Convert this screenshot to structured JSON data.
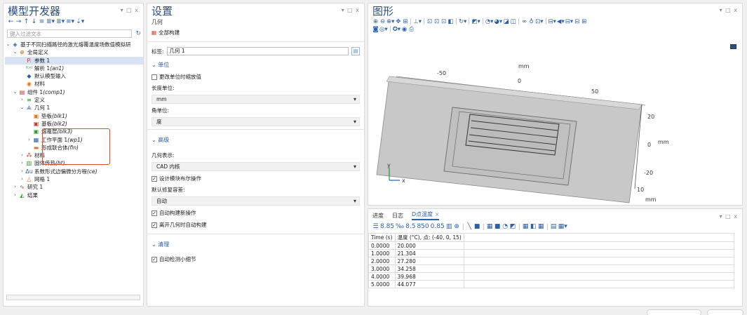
{
  "model_builder": {
    "title": "模型开发器",
    "window_controls": "▾ □ ⅹ",
    "filter_placeholder": "键入过滤文本",
    "tree": [
      {
        "label": "基于不同扫描路径的激光熔覆温度场数值模拟研",
        "italic": "",
        "icon": "◈",
        "indent": 0,
        "twisty": "⌄"
      },
      {
        "label": "全局定义",
        "italic": "",
        "icon": "⊕",
        "indent": 1,
        "twisty": "⌄"
      },
      {
        "label": "参数 1",
        "italic": "",
        "icon": "Pᵢ",
        "indent": 2,
        "twisty": "",
        "selected": true
      },
      {
        "label": "解析 1 ",
        "italic": "(an1)",
        "icon": "ᶠ⁽ˣ⁾",
        "indent": 2,
        "twisty": ""
      },
      {
        "label": "默认模型输入",
        "italic": "",
        "icon": "◆",
        "indent": 2,
        "twisty": ""
      },
      {
        "label": "材料",
        "italic": "",
        "icon": "◉",
        "indent": 2,
        "twisty": ""
      },
      {
        "label": "组件 1 ",
        "italic": "(comp1)",
        "icon": "▤",
        "indent": 1,
        "twisty": "⌄"
      },
      {
        "label": "定义",
        "italic": "",
        "icon": "≡",
        "indent": 2,
        "twisty": "›"
      },
      {
        "label": "几何 1",
        "italic": "",
        "icon": "⟁",
        "indent": 2,
        "twisty": "⌄"
      },
      {
        "label": "垫板 ",
        "italic": "(blk1)",
        "icon": "▣",
        "indent": 3,
        "twisty": ""
      },
      {
        "label": "基板 ",
        "italic": "(blk2)",
        "icon": "▣",
        "indent": 3,
        "twisty": ""
      },
      {
        "label": "熔覆层 ",
        "italic": "(blk3)",
        "icon": "▣",
        "indent": 3,
        "twisty": ""
      },
      {
        "label": "工作平面 1 ",
        "italic": "(wp1)",
        "icon": "▦",
        "indent": 3,
        "twisty": "›"
      },
      {
        "label": "形成联合体 ",
        "italic": "(fin)",
        "icon": "▬",
        "indent": 3,
        "twisty": ""
      },
      {
        "label": "材料",
        "italic": "",
        "icon": "⁂",
        "indent": 2,
        "twisty": "›"
      },
      {
        "label": "固体传热 ",
        "italic": "(ht)",
        "icon": "▥",
        "indent": 2,
        "twisty": "›"
      },
      {
        "label": "系数形式边偏微分方程 ",
        "italic": "(ce)",
        "icon": "Δu",
        "indent": 2,
        "twisty": "›"
      },
      {
        "label": "网格 1",
        "italic": "",
        "icon": "△",
        "indent": 2,
        "twisty": "›"
      },
      {
        "label": "研究 1",
        "italic": "",
        "icon": "∿",
        "indent": 1,
        "twisty": "›"
      },
      {
        "label": "结果",
        "italic": "",
        "icon": "◭",
        "indent": 1,
        "twisty": "›"
      }
    ]
  },
  "settings": {
    "title": "设置",
    "subtitle": "几何",
    "window_controls": "▾ □ ⅹ",
    "build_all": "全部构建",
    "label_caption": "标签:",
    "label_value": "几何 1",
    "section_units": "单位",
    "scale_values_label": "更改单位时缩放值",
    "length_unit_label": "长度单位:",
    "length_unit_value": "mm",
    "angle_unit_label": "角单位:",
    "angle_unit_value": "度",
    "section_advanced": "高级",
    "geom_repr_label": "几何表示:",
    "geom_repr_value": "CAD 内核",
    "design_boolean_label": "设计模块布尔操作",
    "repair_tol_label": "默认修复容差:",
    "repair_tol_value": "自动",
    "auto_build_label": "自动构建新操作",
    "auto_build_leave_label": "离开几何时自动构建",
    "section_cleanup": "清理",
    "detect_small_label": "自动检测小细节"
  },
  "graphics": {
    "title": "图形",
    "window_controls": "▾ □ ⅹ",
    "toolbar_row1": [
      "⊕",
      "⊖",
      "⊕▾",
      "✥",
      "⊞",
      "│",
      "⊥▾",
      "│",
      "⊡",
      "⊡",
      "⊡",
      "◧",
      "│",
      "↻▾",
      "│",
      "◩▾",
      "│",
      "◔▾",
      "◕▾",
      "◪",
      "◫",
      "│",
      "∞",
      "♁",
      "⊡▾",
      "│",
      "⊟▾",
      "◀▾",
      "⊟▾",
      "⊟",
      "⊞"
    ],
    "toolbar_row2": [
      "◙",
      "◎▾",
      "│",
      "✪▾",
      "◉",
      "⎙"
    ],
    "top_unit": "mm",
    "top_ticks": [
      "-50",
      "0",
      "50"
    ],
    "right_ticks": [
      "20",
      "0",
      "-20",
      "10"
    ],
    "right_unit_top": "mm",
    "right_unit_bottom": "mm",
    "axis_y": "y",
    "axis_x": "x"
  },
  "results": {
    "tabs": [
      "进度",
      "日志",
      "D点温度"
    ],
    "active_tab": "D点温度",
    "close_glyph": "×",
    "window_controls": "▾ □ ⅹ",
    "toolbar": [
      "☰",
      "8.85",
      "‰",
      "8.5",
      "850",
      "0.85",
      "▥",
      "⊕",
      "│",
      "╲",
      "■",
      "│",
      "▦",
      "■",
      "◔",
      "◩",
      "│",
      "▦",
      "◧",
      "▦",
      "│",
      "▤",
      "▦▾"
    ],
    "columns": [
      "Time (s)",
      "温度 (°C), 点: (-40, 0, 15)"
    ],
    "rows": [
      [
        "0.0000",
        "20.000"
      ],
      [
        "1.0000",
        "21.304"
      ],
      [
        "2.0000",
        "27.280"
      ],
      [
        "3.0000",
        "34.258"
      ],
      [
        "4.0000",
        "39.968"
      ],
      [
        "5.0000",
        "44.077"
      ]
    ]
  },
  "colors": {
    "title_blue": "#2a4d7f",
    "accent_blue": "#2a5ea8",
    "highlight_red": "#e04a2c",
    "selection": "#d7e3f5"
  }
}
